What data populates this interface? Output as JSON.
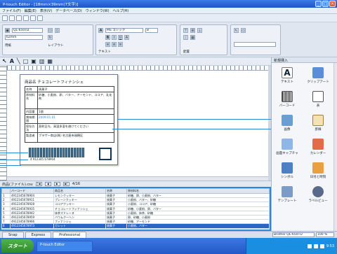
{
  "window": {
    "title": "P-touch Editor - [18mm×39mm(7文字)]"
  },
  "menu": [
    "ファイル(F)",
    "編集(E)",
    "表示(V)",
    "データベース(D)",
    "ウィンドウ(W)",
    "ヘルプ(H)"
  ],
  "properties": {
    "font_name": "MS ゴシック",
    "font_size": "8",
    "printer": "QL-650TD",
    "tape_width": "62mm",
    "paper_label": "用紙",
    "layout_label": "レイアウト",
    "text_label": "テキスト",
    "align_label": "配置"
  },
  "drawing_tools": [
    "選択",
    "テキスト",
    "線",
    "図形",
    "画像",
    "バーコード",
    "表"
  ],
  "label": {
    "title": "商品名 チョコレートフィナンシェ",
    "rows": [
      {
        "key": "名称",
        "value": "焼菓子"
      },
      {
        "key": "原材料名",
        "value": "砂糖、小麦粉、卵、バター、アーモンド、ココア、乳化剤"
      },
      {
        "key": "内容量",
        "value": "1個"
      },
      {
        "key": "賞味期限",
        "value": "2009.01.01"
      },
      {
        "key": "保存方法",
        "value": "直射日光、高温多湿を避けてください"
      },
      {
        "key": "製造者",
        "value": "ブラザー商店(株) 名古屋市瑞穂区"
      }
    ],
    "barcode_number": "4 912345 678904"
  },
  "database": {
    "filename": "商品(ファイル).csv",
    "record": "4/16",
    "columns": [
      "",
      "バーコード",
      "商品名",
      "名称",
      "原材料名"
    ],
    "rows": [
      [
        "1",
        "4912345678904",
        "レモンクッキー",
        "焼菓子",
        "砂糖、卵、小麦粉、バター"
      ],
      [
        "2",
        "4912345678911",
        "プレーンクッキー",
        "焼菓子",
        "小麦粉、バター、砂糖"
      ],
      [
        "3",
        "4912345678928",
        "ココアクッキー",
        "焼菓子",
        "小麦粉、ココア、砂糖"
      ],
      [
        "4",
        "4912345678935",
        "チョコレートフィナンシェ",
        "焼菓子",
        "砂糖、小麦粉、卵、バター"
      ],
      [
        "5",
        "4912345678942",
        "抹茶マドレーヌ",
        "焼菓子",
        "小麦粉、抹茶、砂糖"
      ],
      [
        "6",
        "4912345678959",
        "バウムクーヘン",
        "焼菓子",
        "卵、砂糖、小麦粉"
      ],
      [
        "7",
        "4912345678966",
        "フィナンシェ",
        "焼菓子",
        "砂糖、アーモンド"
      ],
      [
        "8",
        "4912345678973",
        "ガレット",
        "焼菓子",
        "小麦粉、バター"
      ]
    ]
  },
  "right_panel": {
    "header": "新規挿入",
    "items": [
      "テキスト",
      "クリップアート",
      "バーコード",
      "表",
      "画像",
      "罫線",
      "画面キャプチャ",
      "カレンダー",
      "シンボル",
      "日付と時刻",
      "テンプレート",
      "ラベルビュー"
    ]
  },
  "tabs": [
    "Snap",
    "Express",
    "Professional"
  ],
  "status": {
    "printer": "Brother QL-650TD",
    "zoom": "100 %"
  },
  "taskbar": {
    "start": "スタート",
    "task": "P-touch Editor",
    "clock": "9:53"
  }
}
